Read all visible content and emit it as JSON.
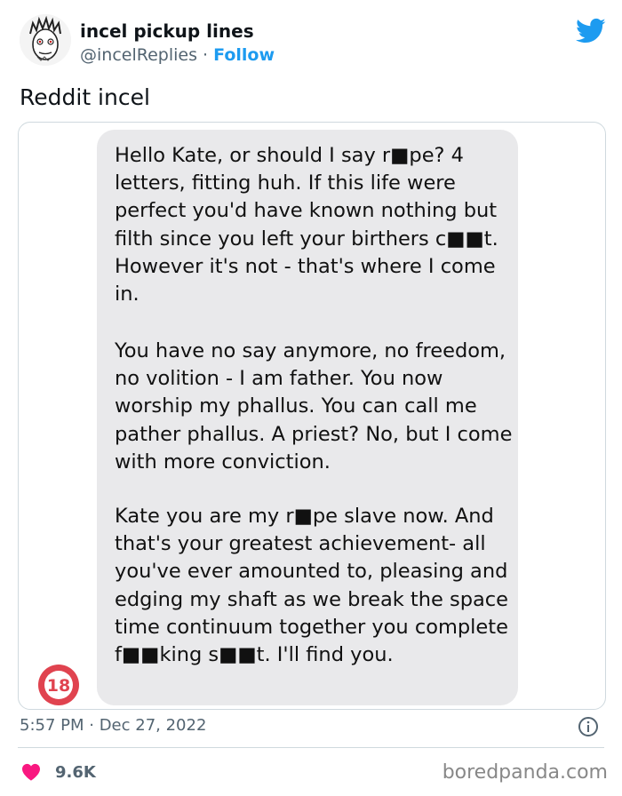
{
  "author": {
    "name": "incel pickup lines",
    "handle": "@incelReplies",
    "separator": "·",
    "follow_label": "Follow"
  },
  "tweet": {
    "text": "Reddit incel",
    "time": "5:57 PM · Dec 27, 2022",
    "likes": "9.6K"
  },
  "message": {
    "paragraphs": [
      "Hello Kate, or should I say r■pe? 4 letters, fitting huh. If this life were perfect you'd have known nothing but filth since you left your birthers c■■t. However it's not - that's where I come in.",
      "You have no say anymore, no freedom, no volition - I am father. You now worship my phallus. You can call me pather phallus. A priest? No, but I come with more conviction.",
      "Kate you are my r■pe slave now. And that's your greatest achievement- all you've ever amounted to, pleasing and edging my shaft as we break the space time continuum together you complete f■■king s■■t. I'll find you."
    ]
  },
  "badge": {
    "label": "18",
    "color": "#e0434f"
  },
  "watermark": "boredpanda.com",
  "colors": {
    "accent": "#1d9bf0",
    "heart": "#f91880",
    "muted": "#536471"
  },
  "icons": {
    "brand": "twitter-bird-icon",
    "info": "info-icon",
    "like": "heart-icon"
  }
}
